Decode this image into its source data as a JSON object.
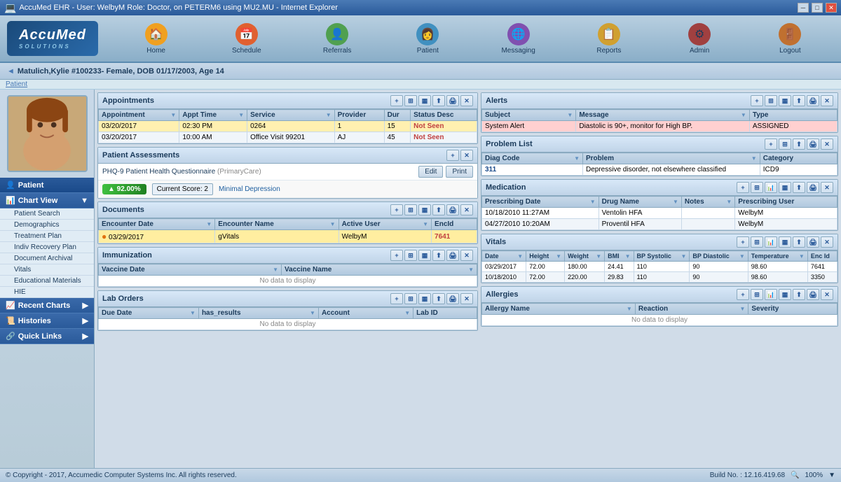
{
  "window": {
    "title": "AccuMed EHR - User: WelbyM Role: Doctor, on PETERM6 using MU2.MU - Internet Explorer"
  },
  "logo": {
    "name": "AccuMed",
    "tagline": "SOLUTIONS"
  },
  "nav": {
    "items": [
      {
        "id": "home",
        "label": "Home",
        "icon": "🏠"
      },
      {
        "id": "schedule",
        "label": "Schedule",
        "icon": "📅"
      },
      {
        "id": "referrals",
        "label": "Referrals",
        "icon": "👤"
      },
      {
        "id": "patient",
        "label": "Patient",
        "icon": "👩"
      },
      {
        "id": "messaging",
        "label": "Messaging",
        "icon": "🌐"
      },
      {
        "id": "reports",
        "label": "Reports",
        "icon": "📋"
      },
      {
        "id": "admin",
        "label": "Admin",
        "icon": "⚙"
      },
      {
        "id": "logout",
        "label": "Logout",
        "icon": "🚪"
      }
    ]
  },
  "patient_bar": {
    "breadcrumb": "Patient",
    "info": "Matulich,Kylie #100233- Female, DOB 01/17/2003, Age 14"
  },
  "sidebar": {
    "patient_section": "Patient",
    "chart_view": "Chart View",
    "items": [
      "Patient Search",
      "Demographics",
      "Treatment Plan",
      "Indiv Recovery Plan",
      "Document Archival",
      "Vitals",
      "Educational Materials",
      "HIE"
    ],
    "recent_charts": "Recent Charts",
    "histories": "Histories",
    "quick_links": "Quick Links"
  },
  "appointments": {
    "title": "Appointments",
    "columns": [
      "Appointment",
      "Appt Time",
      "Service",
      "Provider",
      "Dur",
      "Status Desc"
    ],
    "rows": [
      {
        "date": "03/20/2017",
        "time": "02:30 PM",
        "service": "0264",
        "provider": "1",
        "dur": "15",
        "status": "Not Seen",
        "highlight": true
      },
      {
        "date": "03/20/2017",
        "time": "10:00 AM",
        "service": "Office Visit 99201",
        "provider": "AJ",
        "dur": "45",
        "status": "Not Seen",
        "highlight": false
      }
    ]
  },
  "patient_assessments": {
    "title": "Patient Assessments",
    "phq": {
      "label": "PHQ-9 Patient Health Questionnaire",
      "category": "(PrimaryCare)",
      "score_pct": "▲ 92.00%",
      "current_score_label": "Current Score: 2",
      "interpretation": "Minimal Depression",
      "edit_label": "Edit",
      "print_label": "Print"
    }
  },
  "documents": {
    "title": "Documents",
    "columns": [
      "Encounter Date",
      "Encounter Name",
      "Active User",
      "EncId"
    ],
    "rows": [
      {
        "date": "03/29/2017",
        "name": "gVitals",
        "user": "WelbyM",
        "enc_id": "7641",
        "highlight": true
      }
    ]
  },
  "immunization": {
    "title": "Immunization",
    "columns": [
      "Vaccine Date",
      "Vaccine Name"
    ],
    "no_data": "No data to display"
  },
  "lab_orders": {
    "title": "Lab Orders",
    "columns": [
      "Due Date",
      "has_results",
      "Account",
      "Lab ID"
    ],
    "no_data": "No data to display"
  },
  "alerts": {
    "title": "Alerts",
    "columns": [
      "Subject",
      "Message",
      "Type"
    ],
    "rows": [
      {
        "subject": "System Alert",
        "message": "Diastolic is 90+, monitor for High BP.",
        "type": "ASSIGNED",
        "alert": true
      }
    ]
  },
  "problem_list": {
    "title": "Problem List",
    "columns": [
      "Diag Code",
      "Problem",
      "Category"
    ],
    "rows": [
      {
        "diag_code": "311",
        "problem": "Depressive disorder, not elsewhere classified",
        "category": "ICD9"
      }
    ]
  },
  "medication": {
    "title": "Medication",
    "columns": [
      "Prescribing Date",
      "Drug Name",
      "Notes",
      "Prescribing User"
    ],
    "rows": [
      {
        "date": "10/18/2010 11:27AM",
        "drug": "Ventolin HFA",
        "notes": "",
        "user": "WelbyM"
      },
      {
        "date": "04/27/2010 10:20AM",
        "drug": "Proventil HFA",
        "notes": "",
        "user": "WelbyM"
      }
    ]
  },
  "vitals": {
    "title": "Vitals",
    "columns": [
      "Date",
      "Height",
      "Weight",
      "BMI",
      "BP Systolic",
      "BP Diastolic",
      "Temperature",
      "Enc Id"
    ],
    "rows": [
      {
        "date": "03/29/2017",
        "height": "72.00",
        "weight": "180.00",
        "bmi": "24.41",
        "bp_sys": "110",
        "bp_dia": "90",
        "temp": "98.60",
        "enc_id": "7641"
      },
      {
        "date": "10/18/2010",
        "height": "72.00",
        "weight": "220.00",
        "bmi": "29.83",
        "bp_sys": "110",
        "bp_dia": "90",
        "temp": "98.60",
        "enc_id": "3350"
      }
    ]
  },
  "allergies": {
    "title": "Allergies",
    "columns": [
      "Allergy Name",
      "Reaction",
      "Severity"
    ],
    "no_data": "No data to display"
  },
  "status_bar": {
    "copyright": "© Copyright - 2017, Accumedic Computer Systems Inc. All rights reserved.",
    "build": "Build No. : 12.16.419.68",
    "zoom": "100%"
  }
}
